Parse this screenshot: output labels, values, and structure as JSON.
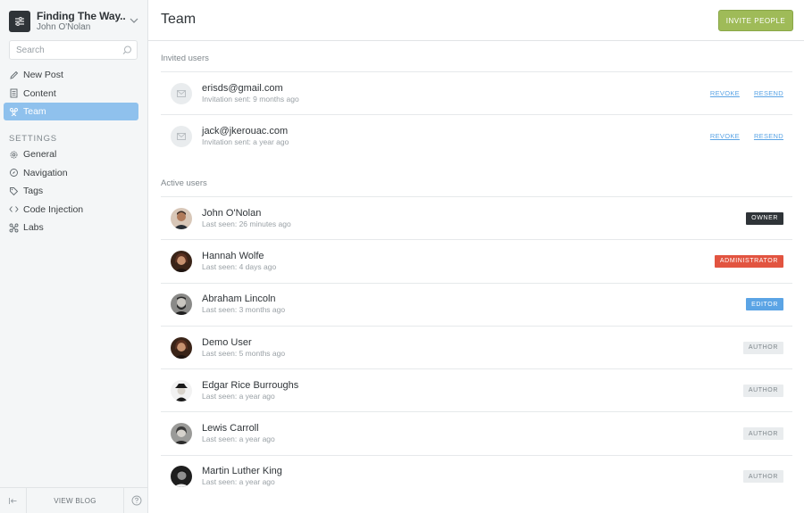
{
  "blog": {
    "title": "Finding The Way...",
    "user": "John O'Nolan"
  },
  "search": {
    "placeholder": "Search"
  },
  "nav": {
    "new_post": "New Post",
    "content": "Content",
    "team": "Team"
  },
  "settings": {
    "heading": "SETTINGS",
    "general": "General",
    "navigation": "Navigation",
    "tags": "Tags",
    "code_injection": "Code Injection",
    "labs": "Labs"
  },
  "footer": {
    "view_blog": "VIEW BLOG"
  },
  "header": {
    "title": "Team",
    "invite_label": "INVITE PEOPLE"
  },
  "invited": {
    "heading": "Invited users",
    "revoke_label": "REVOKE",
    "resend_label": "RESEND",
    "users": [
      {
        "email": "erisds@gmail.com",
        "sent": "Invitation sent: 9 months ago"
      },
      {
        "email": "jack@jkerouac.com",
        "sent": "Invitation sent: a year ago"
      }
    ]
  },
  "active": {
    "heading": "Active users",
    "users": [
      {
        "name": "John O'Nolan",
        "seen": "Last seen: 26 minutes ago",
        "role": "OWNER",
        "role_color": "#2f3438"
      },
      {
        "name": "Hannah Wolfe",
        "seen": "Last seen: 4 days ago",
        "role": "ADMINISTRATOR",
        "role_color": "#e25440"
      },
      {
        "name": "Abraham Lincoln",
        "seen": "Last seen: 3 months ago",
        "role": "EDITOR",
        "role_color": "#5ba4e5"
      },
      {
        "name": "Demo User",
        "seen": "Last seen: 5 months ago",
        "role": "AUTHOR",
        "role_color": "#e9ecee"
      },
      {
        "name": "Edgar Rice Burroughs",
        "seen": "Last seen: a year ago",
        "role": "AUTHOR",
        "role_color": "#e9ecee"
      },
      {
        "name": "Lewis Carroll",
        "seen": "Last seen: a year ago",
        "role": "AUTHOR",
        "role_color": "#e9ecee"
      },
      {
        "name": "Martin Luther King",
        "seen": "Last seen: a year ago",
        "role": "AUTHOR",
        "role_color": "#e9ecee"
      }
    ]
  },
  "colors": {
    "accent": "#8fc1ed",
    "invite_button": "#9fbb58",
    "link": "#5ba4e5"
  }
}
